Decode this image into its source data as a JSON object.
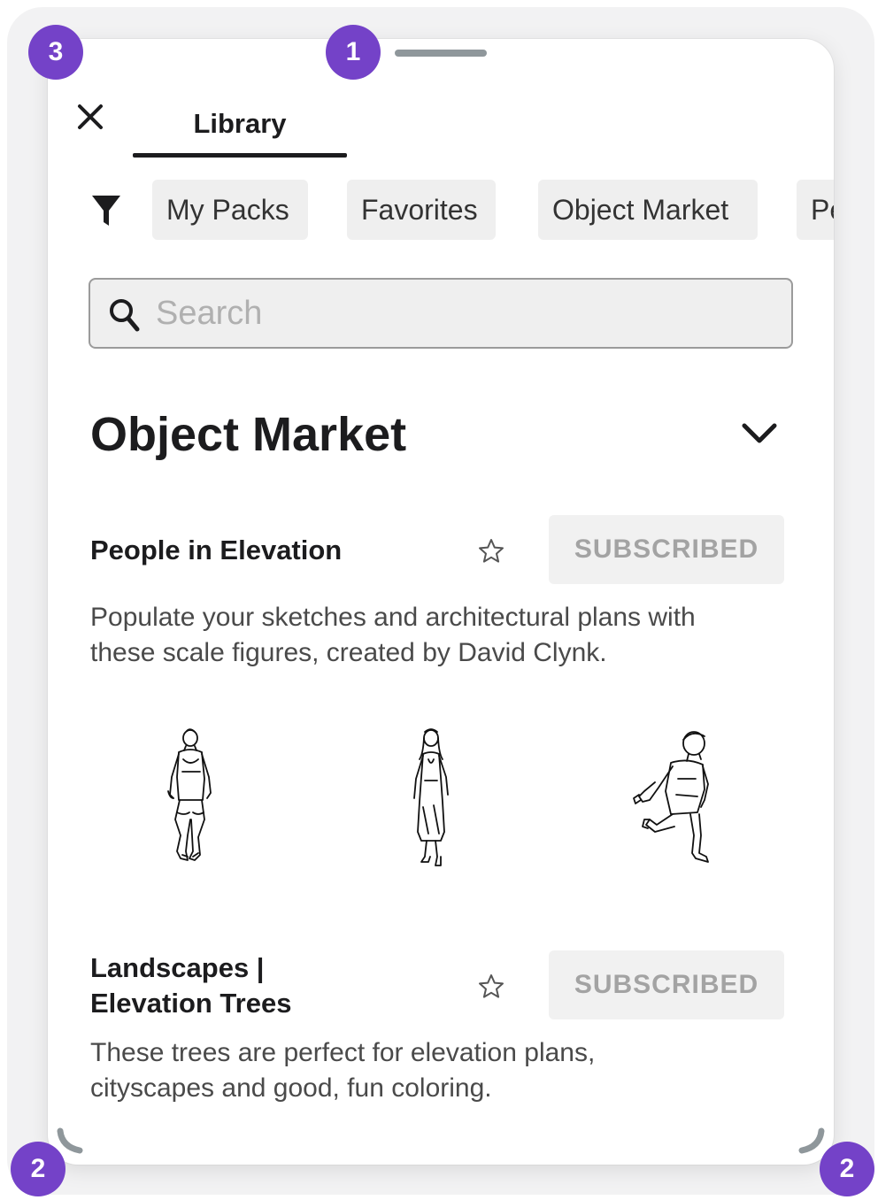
{
  "tabs": {
    "library_label": "Library"
  },
  "filter_chips": [
    "My Packs",
    "Favorites",
    "Object Market",
    "Pe"
  ],
  "search": {
    "placeholder": "Search",
    "value": ""
  },
  "section": {
    "title": "Object Market"
  },
  "packs": [
    {
      "title_lines": [
        "People in Elevation"
      ],
      "button_label": "SUBSCRIBED",
      "description_lines": [
        "Populate your sketches and architectural plans with",
        "these scale figures, created by David Clynk."
      ],
      "preview_icons": [
        "man-walking-figure-icon",
        "woman-walking-figure-icon",
        "boy-running-figure-icon"
      ]
    },
    {
      "title_lines": [
        "Landscapes |",
        "Elevation Trees"
      ],
      "button_label": "SUBSCRIBED",
      "description_lines": [
        "These trees are perfect for elevation plans,",
        "cityscapes and good, fun coloring."
      ]
    }
  ],
  "badges": {
    "top_left": "3",
    "top_center": "1",
    "bottom_left": "2",
    "bottom_right": "2"
  },
  "colors": {
    "badge": "#7442c8",
    "chip_background": "#efefef",
    "subscribed_text": "#a3a3a3",
    "text_primary": "#1c1c1e"
  }
}
